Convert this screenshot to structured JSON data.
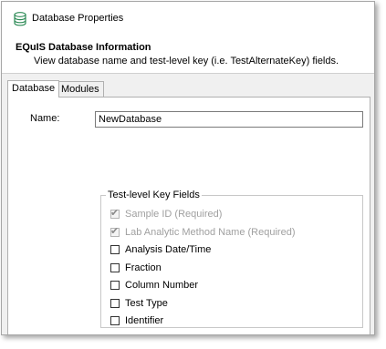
{
  "window": {
    "title": "Database Properties",
    "icon": "database-icon"
  },
  "header": {
    "title": "EQuIS Database Information",
    "subtitle": "View database name and test-level key (i.e. TestAlternateKey) fields."
  },
  "tabs": [
    {
      "label": "Database",
      "active": true
    },
    {
      "label": "Modules",
      "active": false
    }
  ],
  "form": {
    "name_label": "Name:",
    "name_value": "NewDatabase"
  },
  "key_fields": {
    "legend": "Test-level Key Fields",
    "items": [
      {
        "label": "Sample ID (Required)",
        "checked": true,
        "disabled": true
      },
      {
        "label": "Lab Analytic Method Name (Required)",
        "checked": true,
        "disabled": true
      },
      {
        "label": "Analysis Date/Time",
        "checked": false,
        "disabled": false
      },
      {
        "label": "Fraction",
        "checked": false,
        "disabled": false
      },
      {
        "label": "Column Number",
        "checked": false,
        "disabled": false
      },
      {
        "label": "Test Type",
        "checked": false,
        "disabled": false
      },
      {
        "label": "Identifier",
        "checked": false,
        "disabled": false
      }
    ]
  },
  "colors": {
    "border": "#b0b0b0",
    "panel_bg": "#f0f0f0",
    "disabled_text": "#a0a0a0",
    "icon_accent": "#2e8b57"
  }
}
